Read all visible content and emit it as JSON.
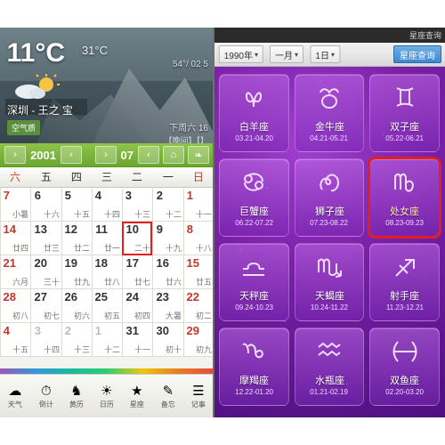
{
  "left_panel": {
    "weather": {
      "temperature": "11°C",
      "temp_small": "31°C",
      "city": "深圳 - 王之 宝",
      "date_line": "下周六 16",
      "sub_line": "【晚间】【】",
      "left_note": "54°/ 02 5",
      "tag": "空气质"
    },
    "toolbar": {
      "month_value": "07",
      "year_value": "2001",
      "prev_icon": "‹",
      "next_icon": "›",
      "home_icon": "⌂",
      "leaf_icon": "❧"
    },
    "week_headers": [
      "日",
      "一",
      "二",
      "三",
      "四",
      "五",
      "六"
    ],
    "days": [
      {
        "sol": "1",
        "lun": "十一",
        "dim": false,
        "red": true,
        "sel": false
      },
      {
        "sol": "2",
        "lun": "十二",
        "dim": false,
        "red": false,
        "sel": false
      },
      {
        "sol": "3",
        "lun": "十三",
        "dim": false,
        "red": false,
        "sel": false
      },
      {
        "sol": "4",
        "lun": "十四",
        "dim": false,
        "red": false,
        "sel": false
      },
      {
        "sol": "5",
        "lun": "十五",
        "dim": false,
        "red": false,
        "sel": false
      },
      {
        "sol": "6",
        "lun": "十六",
        "dim": false,
        "red": false,
        "sel": false
      },
      {
        "sol": "7",
        "lun": "小暑",
        "dim": false,
        "red": true,
        "sel": false
      },
      {
        "sol": "8",
        "lun": "十八",
        "dim": false,
        "red": true,
        "sel": false
      },
      {
        "sol": "9",
        "lun": "十九",
        "dim": false,
        "red": false,
        "sel": false
      },
      {
        "sol": "10",
        "lun": "二十",
        "dim": false,
        "red": false,
        "sel": true
      },
      {
        "sol": "11",
        "lun": "廿一",
        "dim": false,
        "red": false,
        "sel": false
      },
      {
        "sol": "12",
        "lun": "廿二",
        "dim": false,
        "red": false,
        "sel": false
      },
      {
        "sol": "13",
        "lun": "廿三",
        "dim": false,
        "red": false,
        "sel": false
      },
      {
        "sol": "14",
        "lun": "廿四",
        "dim": false,
        "red": true,
        "sel": false
      },
      {
        "sol": "15",
        "lun": "廿五",
        "dim": false,
        "red": true,
        "sel": false
      },
      {
        "sol": "16",
        "lun": "廿六",
        "dim": false,
        "red": false,
        "sel": false
      },
      {
        "sol": "17",
        "lun": "廿七",
        "dim": false,
        "red": false,
        "sel": false
      },
      {
        "sol": "18",
        "lun": "廿八",
        "dim": false,
        "red": false,
        "sel": false
      },
      {
        "sol": "19",
        "lun": "廿九",
        "dim": false,
        "red": false,
        "sel": false
      },
      {
        "sol": "20",
        "lun": "三十",
        "dim": false,
        "red": false,
        "sel": false
      },
      {
        "sol": "21",
        "lun": "六月",
        "dim": false,
        "red": true,
        "sel": false
      },
      {
        "sol": "22",
        "lun": "初二",
        "dim": false,
        "red": true,
        "sel": false
      },
      {
        "sol": "23",
        "lun": "大暑",
        "dim": false,
        "red": false,
        "sel": false
      },
      {
        "sol": "24",
        "lun": "初四",
        "dim": false,
        "red": false,
        "sel": false
      },
      {
        "sol": "25",
        "lun": "初五",
        "dim": false,
        "red": false,
        "sel": false
      },
      {
        "sol": "26",
        "lun": "初六",
        "dim": false,
        "red": false,
        "sel": false
      },
      {
        "sol": "27",
        "lun": "初七",
        "dim": false,
        "red": false,
        "sel": false
      },
      {
        "sol": "28",
        "lun": "初八",
        "dim": false,
        "red": true,
        "sel": false
      },
      {
        "sol": "29",
        "lun": "初九",
        "dim": false,
        "red": true,
        "sel": false
      },
      {
        "sol": "30",
        "lun": "初十",
        "dim": false,
        "red": false,
        "sel": false
      },
      {
        "sol": "31",
        "lun": "十一",
        "dim": false,
        "red": false,
        "sel": false
      },
      {
        "sol": "1",
        "lun": "十二",
        "dim": true,
        "red": false,
        "sel": false
      },
      {
        "sol": "2",
        "lun": "十三",
        "dim": true,
        "red": false,
        "sel": false
      },
      {
        "sol": "3",
        "lun": "十四",
        "dim": true,
        "red": false,
        "sel": false
      },
      {
        "sol": "4",
        "lun": "十五",
        "dim": true,
        "red": true,
        "sel": false
      }
    ],
    "taskbar": [
      {
        "icon": "☰",
        "label": "记事"
      },
      {
        "icon": "✎",
        "label": "备忘"
      },
      {
        "icon": "★",
        "label": "星座"
      },
      {
        "icon": "☀",
        "label": "日历"
      },
      {
        "icon": "♞",
        "label": "黄历"
      },
      {
        "icon": "⏱",
        "label": "倒计"
      },
      {
        "icon": "☁",
        "label": "天气"
      }
    ]
  },
  "right_panel": {
    "window_label": "星座查询",
    "toolbar": {
      "query_button": "星座查询",
      "day_select": "1日",
      "month_select": "一月",
      "year_select": "1990年",
      "caret": "▾"
    },
    "signs": [
      {
        "name": "双子座",
        "dates": "05.22-06.21",
        "glyph": "gemini"
      },
      {
        "name": "金牛座",
        "dates": "04.21-05.21",
        "glyph": "taurus"
      },
      {
        "name": "白羊座",
        "dates": "03.21-04.20",
        "glyph": "aries"
      },
      {
        "name": "处女座",
        "dates": "08.23-09.23",
        "glyph": "virgo"
      },
      {
        "name": "狮子座",
        "dates": "07.23-08.22",
        "glyph": "leo"
      },
      {
        "name": "巨蟹座",
        "dates": "06.22-07.22",
        "glyph": "cancer"
      },
      {
        "name": "射手座",
        "dates": "11.23-12.21",
        "glyph": "sagittarius"
      },
      {
        "name": "天蝎座",
        "dates": "10.24-11.22",
        "glyph": "scorpio"
      },
      {
        "name": "天秤座",
        "dates": "09.24-10.23",
        "glyph": "libra"
      },
      {
        "name": "双鱼座",
        "dates": "02.20-03.20",
        "glyph": "pisces"
      },
      {
        "name": "水瓶座",
        "dates": "01.21-02.19",
        "glyph": "aquarius"
      },
      {
        "name": "摩羯座",
        "dates": "12.22-01.20",
        "glyph": "capricorn"
      }
    ],
    "highlighted_sign_index": 3
  }
}
